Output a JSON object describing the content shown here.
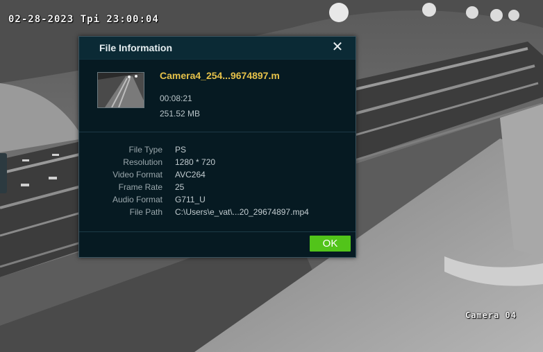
{
  "osd": {
    "timestamp": "02-28-2023 Tpi 23:00:04",
    "camera_label": "Camera 04"
  },
  "dialog": {
    "title": "File Information",
    "close_icon": "close-icon",
    "file_name": "Camera4_254...9674897.m",
    "duration": "00:08:21",
    "size": "251.52 MB",
    "properties": [
      {
        "label": "File Type",
        "value": "PS"
      },
      {
        "label": "Resolution",
        "value": "1280 * 720"
      },
      {
        "label": "Video Format",
        "value": "AVC264"
      },
      {
        "label": "Frame Rate",
        "value": "25"
      },
      {
        "label": "Audio Format",
        "value": "G711_U"
      },
      {
        "label": "File Path",
        "value": "C:\\Users\\e_vat\\...20_29674897.mp4"
      }
    ],
    "ok_label": "OK"
  },
  "colors": {
    "dialog_bg": "#061a22",
    "titlebar_bg": "#0b2a35",
    "file_name": "#e6c24a",
    "ok_button": "#52c41a"
  }
}
